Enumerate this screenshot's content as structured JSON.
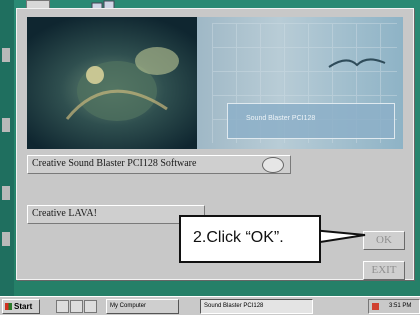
{
  "installer": {
    "banner_text": "Sound Blaster PCI128",
    "options": [
      {
        "label": "Creative Sound Blaster PCI128 Software"
      },
      {
        "label": "Creative LAVA!"
      }
    ],
    "ok_label": "OK",
    "exit_label": "EXIT"
  },
  "callout": {
    "text": "2.Click “OK”."
  },
  "taskbar": {
    "start_label": "Start",
    "tasks": [
      {
        "label": "My Computer"
      },
      {
        "label": "Sound Blaster PCI128"
      }
    ],
    "clock": "3:51 PM"
  },
  "colors": {
    "desktop": "#2a8a74",
    "window": "#c8c8c8",
    "callout_border": "#111111"
  }
}
